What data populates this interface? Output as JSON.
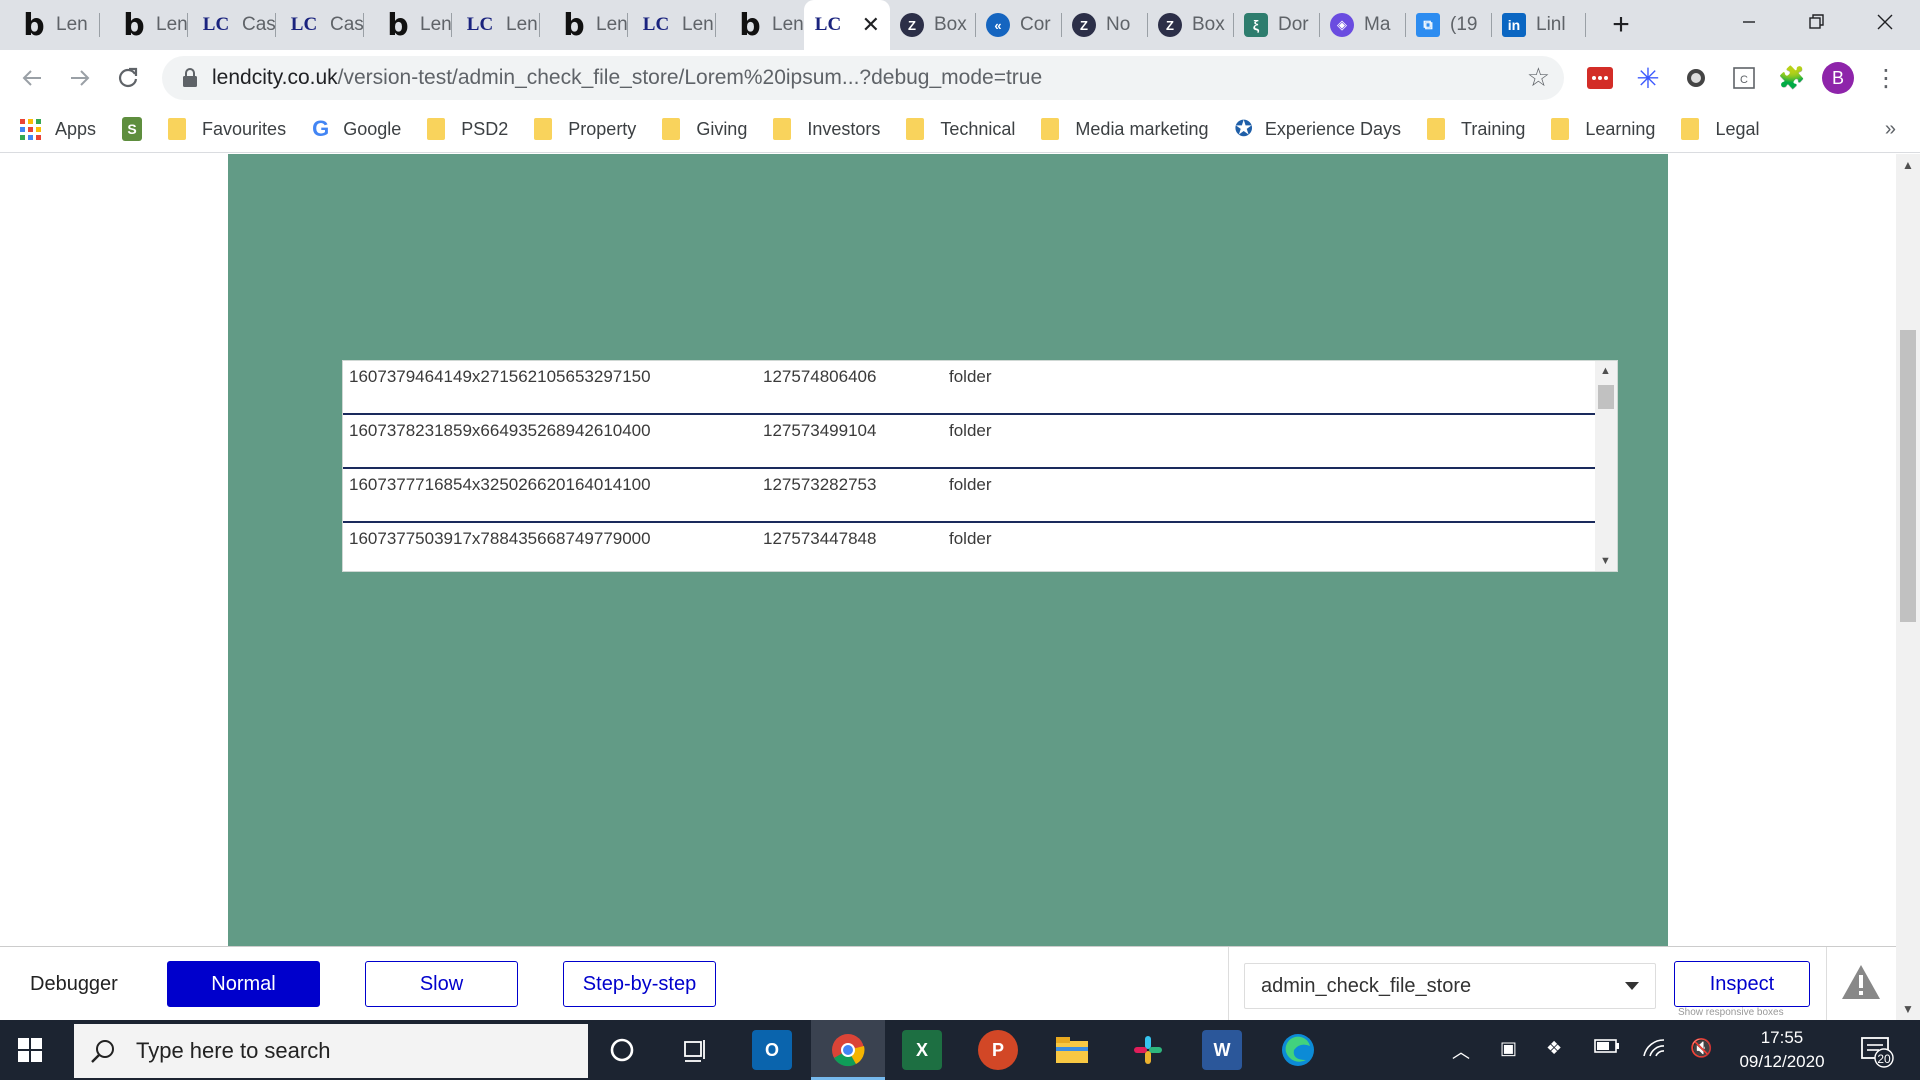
{
  "browser": {
    "tabs": [
      {
        "favicon": "b",
        "label": "Len"
      },
      {
        "favicon": "b",
        "label": "Len"
      },
      {
        "favicon": "LC",
        "label": "Cas"
      },
      {
        "favicon": "LC",
        "label": "Cas"
      },
      {
        "favicon": "b",
        "label": "Len"
      },
      {
        "favicon": "LC",
        "label": "Len"
      },
      {
        "favicon": "b",
        "label": "Len"
      },
      {
        "favicon": "LC",
        "label": "Len"
      },
      {
        "favicon": "b",
        "label": "Len"
      },
      {
        "favicon": "LC",
        "label": ""
      },
      {
        "favicon": "Z",
        "label": "Box"
      },
      {
        "favicon": "«",
        "label": "Cor"
      },
      {
        "favicon": "Z",
        "label": "No"
      },
      {
        "favicon": "Z",
        "label": "Box"
      },
      {
        "favicon": "ξ",
        "label": "Dor"
      },
      {
        "favicon": "◈",
        "label": "Ma"
      },
      {
        "favicon": "⧉",
        "label": "(19"
      },
      {
        "favicon": "in",
        "label": "Linl"
      }
    ],
    "new_tab": "+",
    "url_host": "lendcity.co.uk",
    "url_path": "/version-test/admin_check_file_store/Lorem%20ipsum...?debug_mode=true",
    "profile_initial": "B"
  },
  "bookmarks": {
    "apps": "Apps",
    "items": [
      "Favourites",
      "Google",
      "PSD2",
      "Property",
      "Giving",
      "Investors",
      "Technical",
      "Media marketing",
      "Experience Days",
      "Training",
      "Learning",
      "Legal"
    ],
    "more": "»"
  },
  "file_list": {
    "rows": [
      {
        "id": "1607379464149x271562105653297150",
        "size": "127574806406",
        "type": "folder"
      },
      {
        "id": "1607378231859x664935268942610400",
        "size": "127573499104",
        "type": "folder"
      },
      {
        "id": "1607377716854x325026620164014100",
        "size": "127573282753",
        "type": "folder"
      },
      {
        "id": "1607377503917x788435668749779000",
        "size": "127573447848",
        "type": "folder"
      }
    ]
  },
  "debugger": {
    "title": "Debugger",
    "normal": "Normal",
    "slow": "Slow",
    "step": "Step-by-step",
    "page_select": "admin_check_file_store",
    "inspect": "Inspect",
    "hint": "Show responsive boxes"
  },
  "taskbar": {
    "search_placeholder": "Type here to search",
    "time": "17:55",
    "date": "09/12/2020",
    "notifications": "20"
  },
  "colors": {
    "page_background": "#629b86",
    "debugger_accent": "#0000cc",
    "row_divider": "#1a2a5c"
  }
}
